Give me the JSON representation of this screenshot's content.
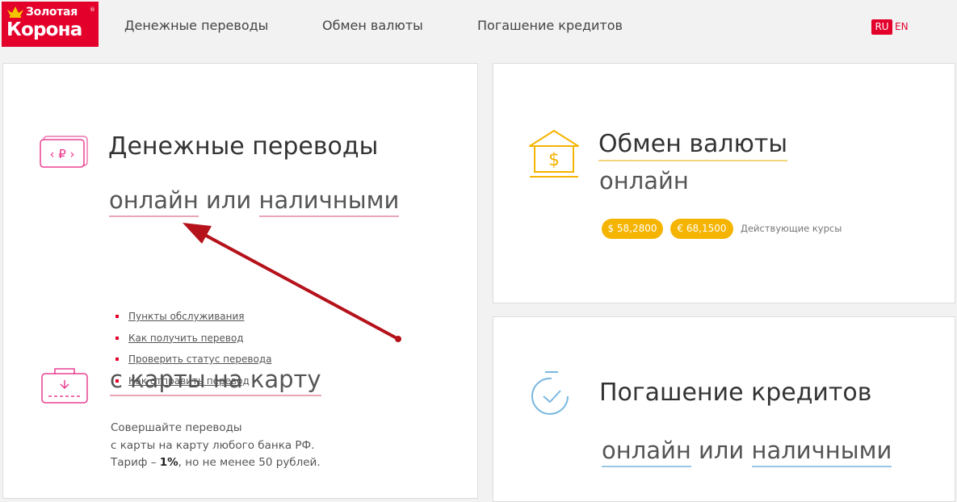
{
  "logo": {
    "line1": "Золотая",
    "line2": "Корона",
    "reg": "®"
  },
  "nav": {
    "transfers": "Денежные переводы",
    "exchange": "Обмен валюты",
    "loans": "Погашение кредитов"
  },
  "lang": {
    "ru": "RU",
    "en": "EN"
  },
  "transfers_card": {
    "title": "Денежные переводы",
    "online": "онлайн",
    "or": "или",
    "cash": "наличными",
    "links": [
      "Пункты обслуживания",
      "Как получить перевод",
      "Проверить статус перевода",
      "Как отправить перевод"
    ],
    "card_to_card": "с карты на карту",
    "desc_line1": "Совершайте переводы",
    "desc_line2": "с карты на карту любого банка РФ.",
    "desc_tariff": "Тариф –",
    "desc_percent": "1%",
    "desc_rest": ", но не менее 50 рублей."
  },
  "exchange_card": {
    "title": "Обмен валюты",
    "online": "онлайн",
    "usd_rate": "$ 58,2800",
    "eur_rate": "€ 68,1500",
    "rates_label": "Действующие курсы"
  },
  "loans_card": {
    "title": "Погашение кредитов",
    "online": "онлайн",
    "or": "или",
    "cash": "наличными"
  },
  "colors": {
    "brand_red": "#e3002b",
    "rate_yellow": "#f5b400",
    "annotation_arrow": "#b5121b"
  }
}
